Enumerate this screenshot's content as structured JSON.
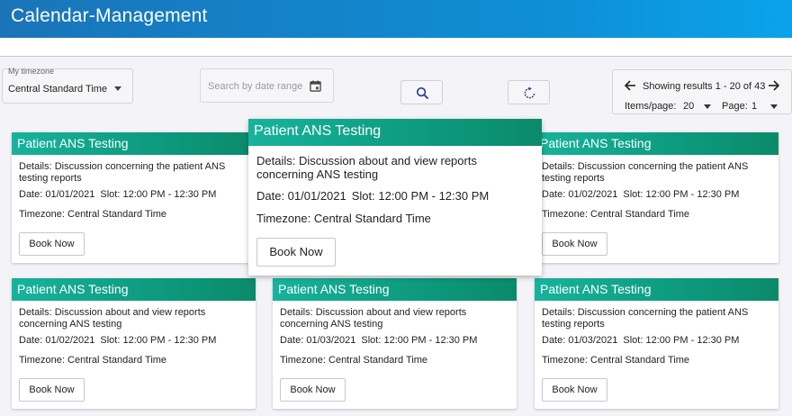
{
  "app": {
    "title": "Calendar-Management"
  },
  "colors": {
    "header": "#0e8fd6",
    "card_header": "#10a387"
  },
  "filters": {
    "timezone_label": "My timezone",
    "timezone_value": "Central Standard Time",
    "date_range_placeholder": "Search by date range"
  },
  "pager": {
    "results": "Showing results 1 - 20 of 43",
    "items_per_page_label": "Items/page:",
    "items_per_page_value": "20",
    "page_label": "Page:",
    "page_value": "1"
  },
  "cards": [
    {
      "title": "Patient ANS Testing",
      "details": "Details: Discussion concerning the patient ANS testing reports",
      "date": "Date: 01/01/2021",
      "slot": "Slot: 12:00 PM - 12:30 PM",
      "timezone": "Timezone: Central Standard Time",
      "button": "Book Now"
    },
    {
      "title": "Patient ANS Testing",
      "details": "Details: Discussion about and view reports concerning ANS testing",
      "date": "Date: 01/01/2021",
      "slot": "Slot: 12:00 PM - 12:30 PM",
      "timezone": "Timezone: Central Standard Time",
      "button": "Book Now"
    },
    {
      "title": "Patient ANS Testing",
      "details": "Details: Discussion concerning the patient ANS testing reports",
      "date": "Date: 01/02/2021",
      "slot": "Slot: 12:00 PM - 12:30 PM",
      "timezone": "Timezone: Central Standard Time",
      "button": "Book Now"
    },
    {
      "title": "Patient ANS Testing",
      "details": "Details: Discussion about and view reports concerning ANS testing",
      "date": "Date: 01/02/2021",
      "slot": "Slot: 12:00 PM - 12:30 PM",
      "timezone": "Timezone: Central Standard Time",
      "button": "Book Now"
    },
    {
      "title": "Patient ANS Testing",
      "details": "Details: Discussion about and view reports concerning ANS testing",
      "date": "Date: 01/03/2021",
      "slot": "Slot: 12:00 PM - 12:30 PM",
      "timezone": "Timezone: Central Standard Time",
      "button": "Book Now"
    },
    {
      "title": "Patient ANS Testing",
      "details": "Details: Discussion concerning the patient ANS testing reports",
      "date": "Date: 01/03/2021",
      "slot": "Slot: 12:00 PM - 12:30 PM",
      "timezone": "Timezone: Central Standard Time",
      "button": "Book Now"
    }
  ]
}
